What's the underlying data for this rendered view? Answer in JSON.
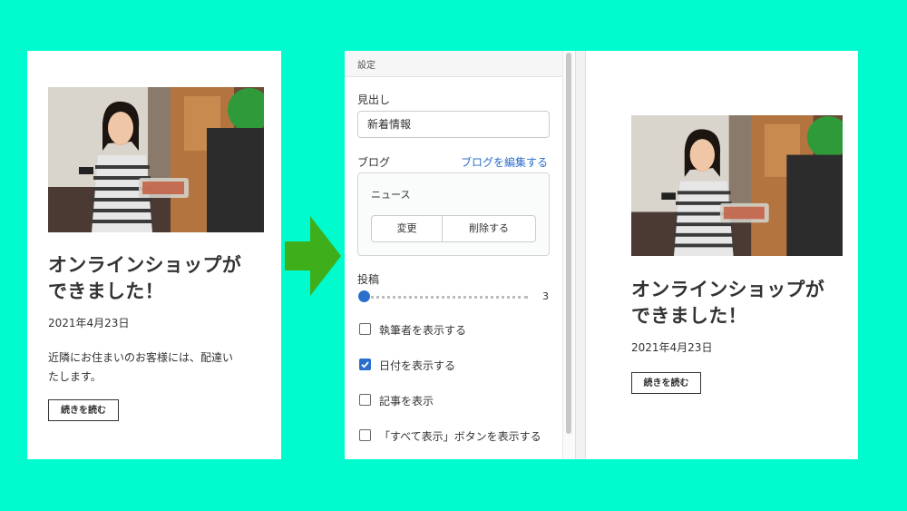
{
  "post": {
    "title_line1": "オンラインショップが",
    "title_line2": "できました！",
    "date": "2021年4月23日",
    "excerpt_line1": "近隣にお住まいのお客様には、配達い",
    "excerpt_line2": "たします。",
    "read_more": "続きを読む"
  },
  "settings": {
    "header": "設定",
    "heading_label": "見出し",
    "heading_value": "新着情報",
    "blog_label": "ブログ",
    "blog_edit_link": "ブログを編集する",
    "blog_name": "ニュース",
    "change_button": "変更",
    "delete_button": "削除する",
    "posts_label": "投稿",
    "posts_count": "3",
    "options": [
      {
        "label": "執筆者を表示する",
        "checked": false
      },
      {
        "label": "日付を表示する",
        "checked": true
      },
      {
        "label": "記事を表示",
        "checked": false
      },
      {
        "label": "「すべて表示」ボタンを表示する",
        "checked": false
      }
    ]
  },
  "colors": {
    "background": "#00fbce",
    "arrow": "#3fae1b",
    "accent": "#2c6ecb"
  }
}
